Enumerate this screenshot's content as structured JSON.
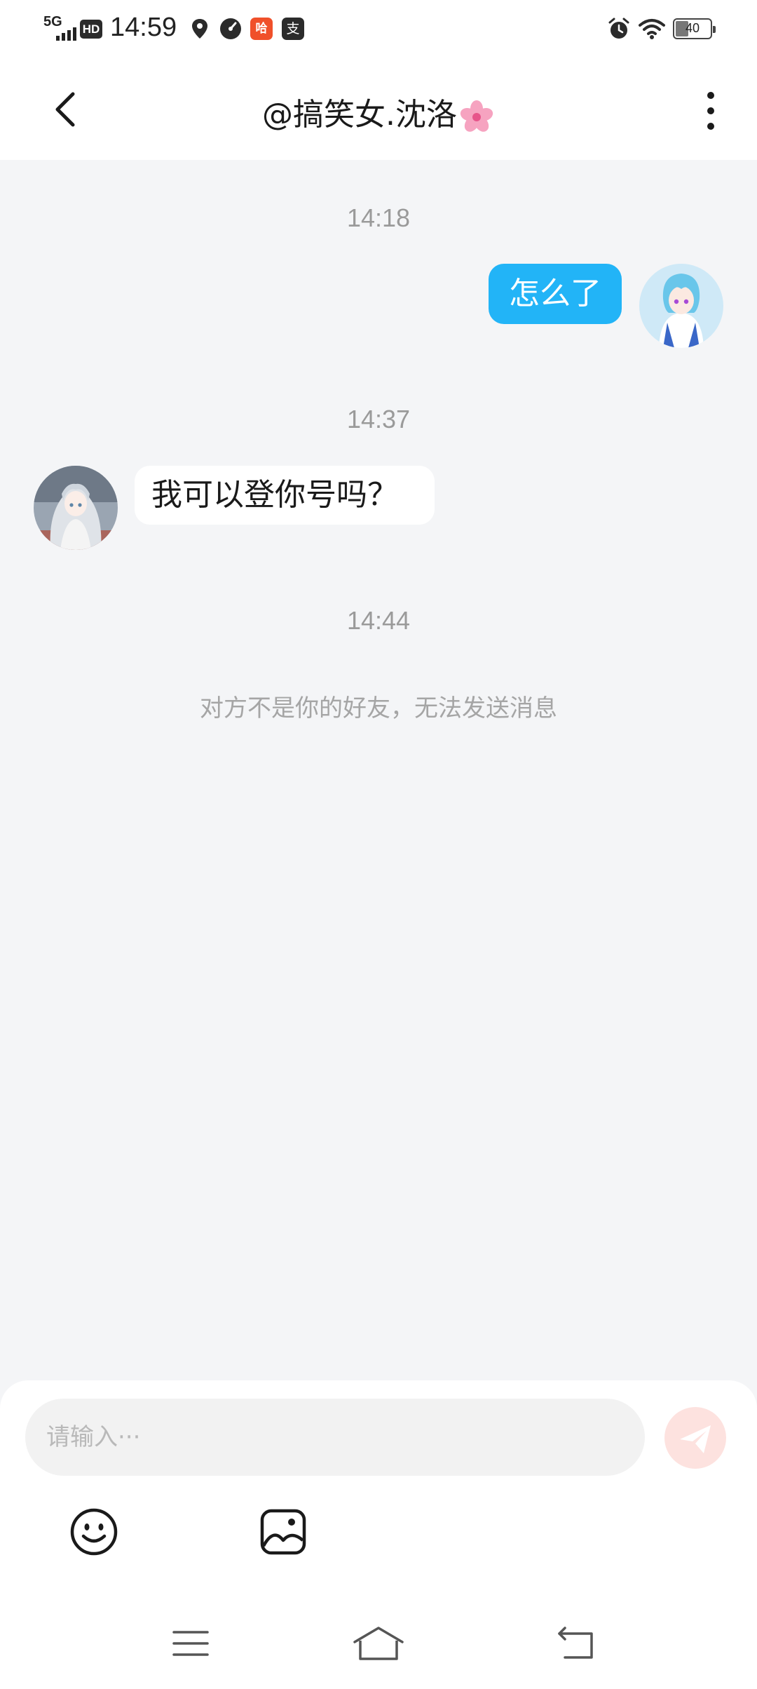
{
  "status_bar": {
    "network": "5G",
    "hd": "HD",
    "time": "14:59",
    "battery": "40",
    "app_badges": [
      "哈",
      "支"
    ]
  },
  "header": {
    "title": "@搞笑女.沈洛",
    "title_emoji_icon": "cherry-blossom-icon"
  },
  "messages": [
    {
      "timestamp": "14:18",
      "direction": "outgoing",
      "text": "怎么了"
    },
    {
      "timestamp": "14:37",
      "direction": "incoming",
      "text": "我可以登你号吗？"
    }
  ],
  "last_timestamp": "14:44",
  "system_notice": "对方不是你的好友，无法发送消息",
  "composer": {
    "placeholder": "请输入···",
    "send_icon": "paper-plane-icon",
    "tools": [
      "emoji-icon",
      "image-icon"
    ]
  },
  "nav": [
    "menu-icon",
    "home-icon",
    "back-icon"
  ],
  "colors": {
    "accent_bubble": "#22b4f7",
    "background": "#f4f5f7",
    "send_button_disabled": "#fde2df"
  }
}
